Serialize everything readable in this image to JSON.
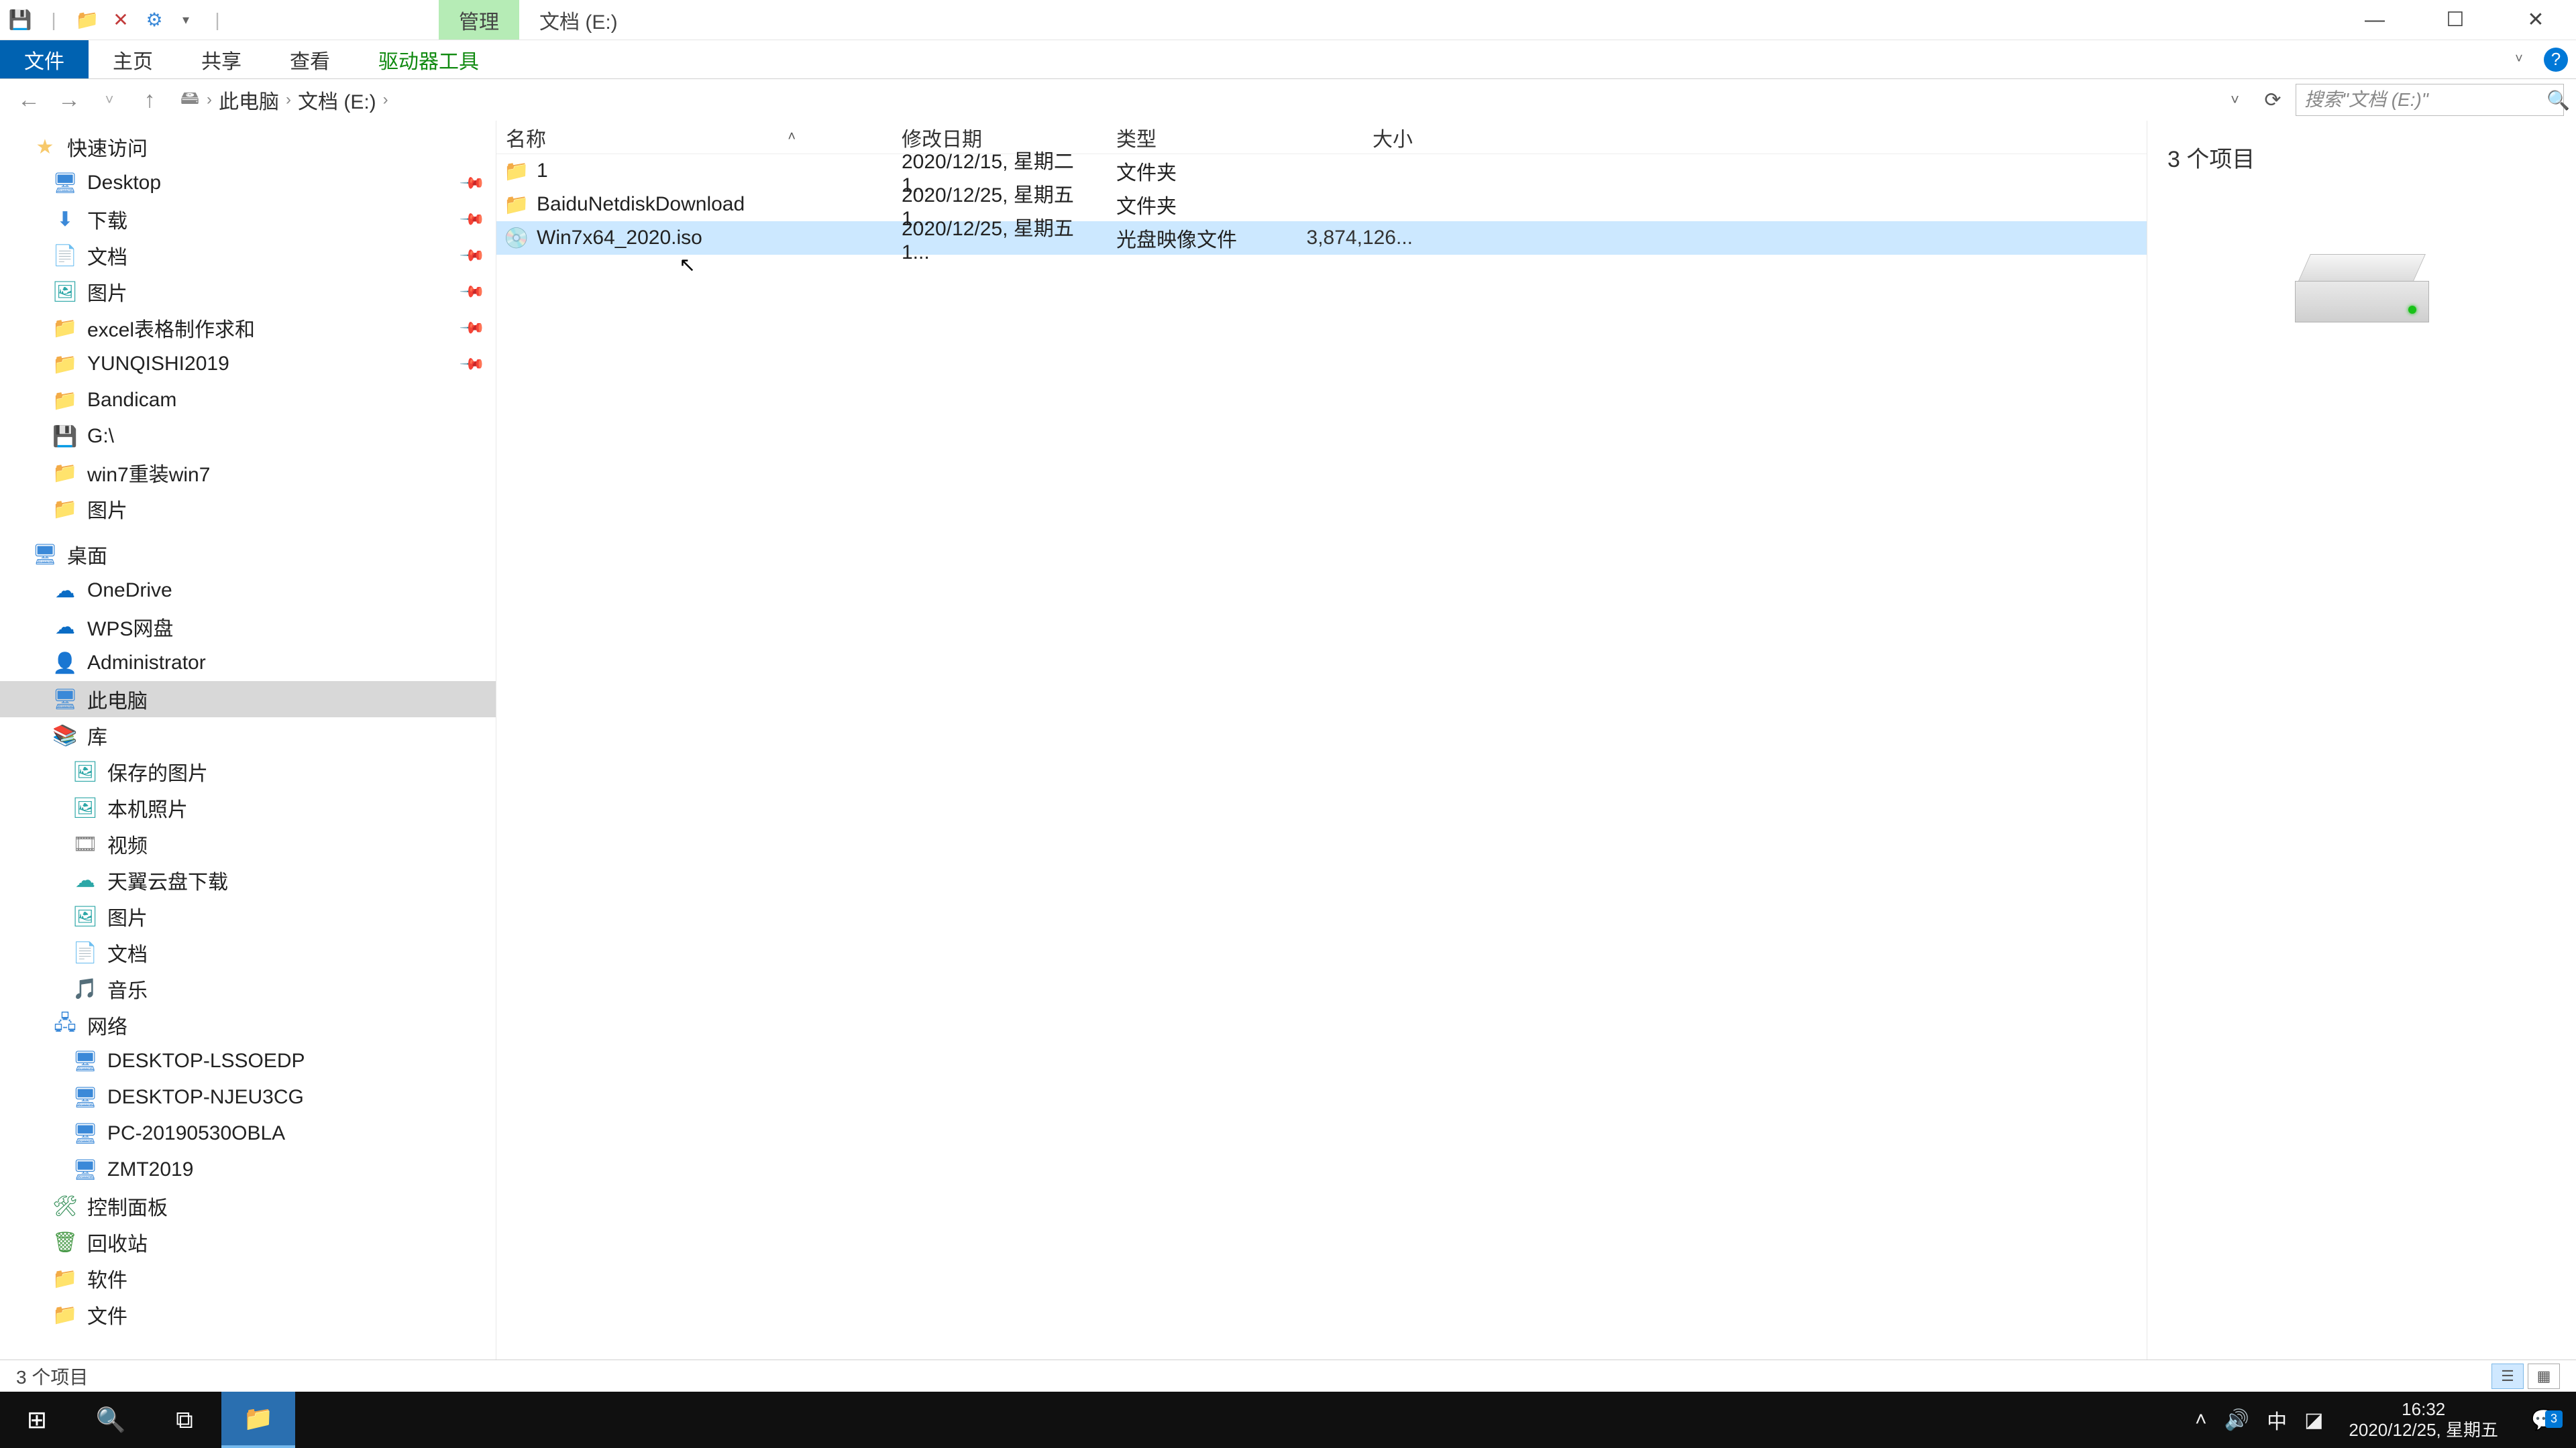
{
  "titlebar": {
    "context_tab": "管理",
    "title": "文档 (E:)"
  },
  "winbtns": {
    "min": "—",
    "max": "☐",
    "close": "✕",
    "help": "?"
  },
  "ribbon": {
    "file": "文件",
    "home": "主页",
    "share": "共享",
    "view": "查看",
    "drive": "驱动器工具"
  },
  "breadcrumb": {
    "root": "此电脑",
    "here": "文档 (E:)"
  },
  "search": {
    "placeholder": "搜索\"文档 (E:)\""
  },
  "columns": {
    "name": "名称",
    "date": "修改日期",
    "type": "类型",
    "size": "大小"
  },
  "rows": [
    {
      "name": "1",
      "date": "2020/12/15, 星期二 1...",
      "type": "文件夹",
      "size": "",
      "icon": "folder",
      "selected": false
    },
    {
      "name": "BaiduNetdiskDownload",
      "date": "2020/12/25, 星期五 1...",
      "type": "文件夹",
      "size": "",
      "icon": "folder",
      "selected": false
    },
    {
      "name": "Win7x64_2020.iso",
      "date": "2020/12/25, 星期五 1...",
      "type": "光盘映像文件",
      "size": "3,874,126...",
      "icon": "disc",
      "selected": true
    }
  ],
  "tree": {
    "quick": "快速访问",
    "quick_items": [
      {
        "label": "Desktop",
        "icon": "desktop",
        "pin": true
      },
      {
        "label": "下载",
        "icon": "download",
        "pin": true
      },
      {
        "label": "文档",
        "icon": "doc",
        "pin": true
      },
      {
        "label": "图片",
        "icon": "pic",
        "pin": true
      },
      {
        "label": "excel表格制作求和",
        "icon": "folder",
        "pin": true
      },
      {
        "label": "YUNQISHI2019",
        "icon": "folder",
        "pin": true
      },
      {
        "label": "Bandicam",
        "icon": "folder",
        "pin": false
      },
      {
        "label": "G:\\",
        "icon": "drive-g",
        "pin": false
      },
      {
        "label": "win7重装win7",
        "icon": "folder",
        "pin": false
      },
      {
        "label": "图片",
        "icon": "folder",
        "pin": false
      }
    ],
    "desktop": "桌面",
    "desktop_items": [
      {
        "label": "OneDrive",
        "icon": "onedrive"
      },
      {
        "label": "WPS网盘",
        "icon": "wps"
      },
      {
        "label": "Administrator",
        "icon": "user"
      },
      {
        "label": "此电脑",
        "icon": "pc",
        "selected": true
      },
      {
        "label": "库",
        "icon": "lib"
      }
    ],
    "lib_items": [
      {
        "label": "保存的图片",
        "icon": "savedpic"
      },
      {
        "label": "本机照片",
        "icon": "photo"
      },
      {
        "label": "视频",
        "icon": "video"
      },
      {
        "label": "天翼云盘下载",
        "icon": "cloud"
      },
      {
        "label": "图片",
        "icon": "pic"
      },
      {
        "label": "文档",
        "icon": "doc"
      },
      {
        "label": "音乐",
        "icon": "music"
      }
    ],
    "network": "网络",
    "net_items": [
      {
        "label": "DESKTOP-LSSOEDP"
      },
      {
        "label": "DESKTOP-NJEU3CG"
      },
      {
        "label": "PC-20190530OBLA"
      },
      {
        "label": "ZMT2019"
      }
    ],
    "ctrl": "控制面板",
    "recycle": "回收站",
    "soft": "软件",
    "docs": "文件"
  },
  "details": {
    "count": "3 个项目"
  },
  "status": {
    "text": "3 个项目"
  },
  "clock": {
    "time": "16:32",
    "date": "2020/12/25, 星期五"
  },
  "ime": "中",
  "notif_badge": "3"
}
